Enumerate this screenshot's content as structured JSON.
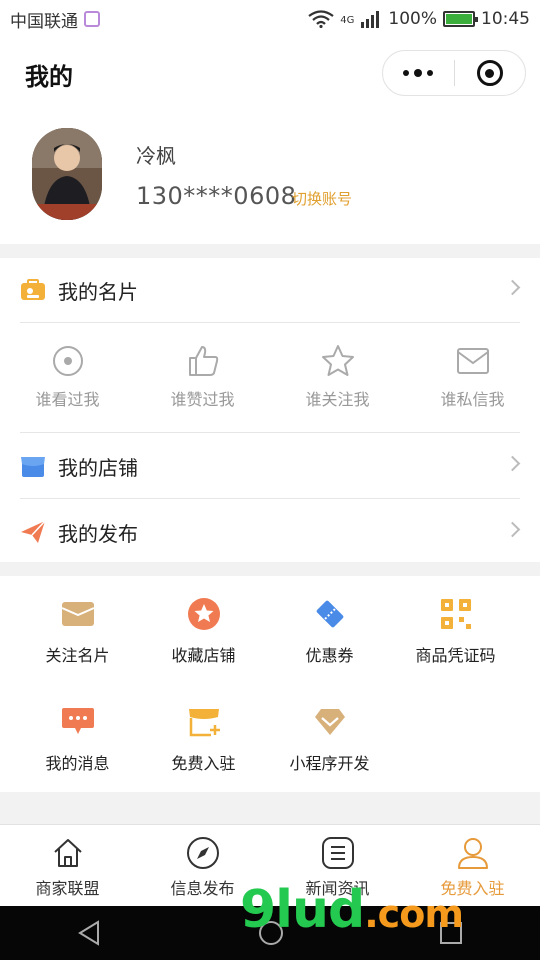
{
  "status_bar": {
    "carrier": "中国联通",
    "network": "4G",
    "battery": "100%",
    "battery_level": 1.0,
    "time": "10:45"
  },
  "header": {
    "title": "我的"
  },
  "profile": {
    "name": "冷枫",
    "phone": "130****0608",
    "switch_account": "切换账号"
  },
  "cards": {
    "my_card": "我的名片",
    "stats": [
      {
        "label": "谁看过我",
        "icon": "eye-icon"
      },
      {
        "label": "谁赞过我",
        "icon": "thumbs-up-icon"
      },
      {
        "label": "谁关注我",
        "icon": "star-icon"
      },
      {
        "label": "谁私信我",
        "icon": "mail-icon"
      }
    ],
    "my_shop": "我的店铺",
    "my_posts": "我的发布"
  },
  "grid": [
    {
      "label": "关注名片",
      "icon": "card-holder-icon",
      "color": "#d8b07a"
    },
    {
      "label": "收藏店铺",
      "icon": "star-badge-icon",
      "color": "#f07b52"
    },
    {
      "label": "优惠券",
      "icon": "coupon-icon",
      "color": "#4a8be8"
    },
    {
      "label": "商品凭证码",
      "icon": "qr-code-icon",
      "color": "#f4b13a"
    },
    {
      "label": "我的消息",
      "icon": "message-icon",
      "color": "#f07b52"
    },
    {
      "label": "免费入驻",
      "icon": "store-add-icon",
      "color": "#f4b13a"
    },
    {
      "label": "小程序开发",
      "icon": "diamond-icon",
      "color": "#d8b07a"
    }
  ],
  "tabbar": [
    {
      "label": "商家联盟",
      "icon": "home-icon",
      "active": false
    },
    {
      "label": "信息发布",
      "icon": "compass-icon",
      "active": false
    },
    {
      "label": "新闻资讯",
      "icon": "list-icon",
      "active": false
    },
    {
      "label": "免费入驻",
      "icon": "user-icon",
      "active": true
    }
  ],
  "watermark": {
    "main": "9lud",
    "suffix": ".com"
  },
  "colors": {
    "accent": "#e69a3a",
    "switch_text": "#e0a030",
    "page_bg": "#f2f2f2"
  }
}
